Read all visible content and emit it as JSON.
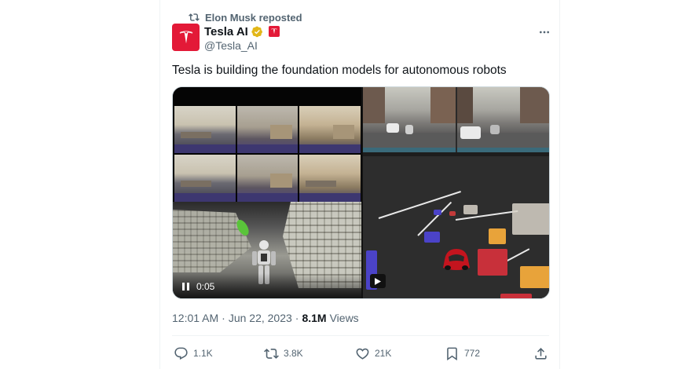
{
  "repost": {
    "label": "Elon Musk reposted",
    "icon": "repost-icon"
  },
  "author": {
    "name": "Tesla AI",
    "handle": "@Tesla_AI",
    "verified": true,
    "affiliation_badge": "tesla-logo-icon",
    "brand_color": "#e31937",
    "verified_color": "#e2b719"
  },
  "more_menu": {
    "icon": "more-icon"
  },
  "tweet": {
    "text": "Tesla is building the foundation models for autonomous robots"
  },
  "video": {
    "timestamp": "0:05",
    "state": "paused",
    "left_panel": "multi-camera-office-and-voxel-reconstruction",
    "right_panel": "driving-cameras-and-birds-eye-occupancy"
  },
  "meta": {
    "time": "12:01 AM",
    "separator": "·",
    "date": "Jun 22, 2023",
    "dot": "·",
    "views_count": "8.1M",
    "views_label": "Views"
  },
  "actions": {
    "reply": {
      "count": "1.1K",
      "icon": "reply-icon"
    },
    "repost": {
      "count": "3.8K",
      "icon": "repost-icon"
    },
    "like": {
      "count": "21K",
      "icon": "heart-icon"
    },
    "bookmark": {
      "count": "772",
      "icon": "bookmark-icon"
    },
    "share": {
      "icon": "share-icon"
    }
  },
  "colors": {
    "text_primary": "#0f1419",
    "text_secondary": "#536471",
    "border": "#eff3f4"
  }
}
